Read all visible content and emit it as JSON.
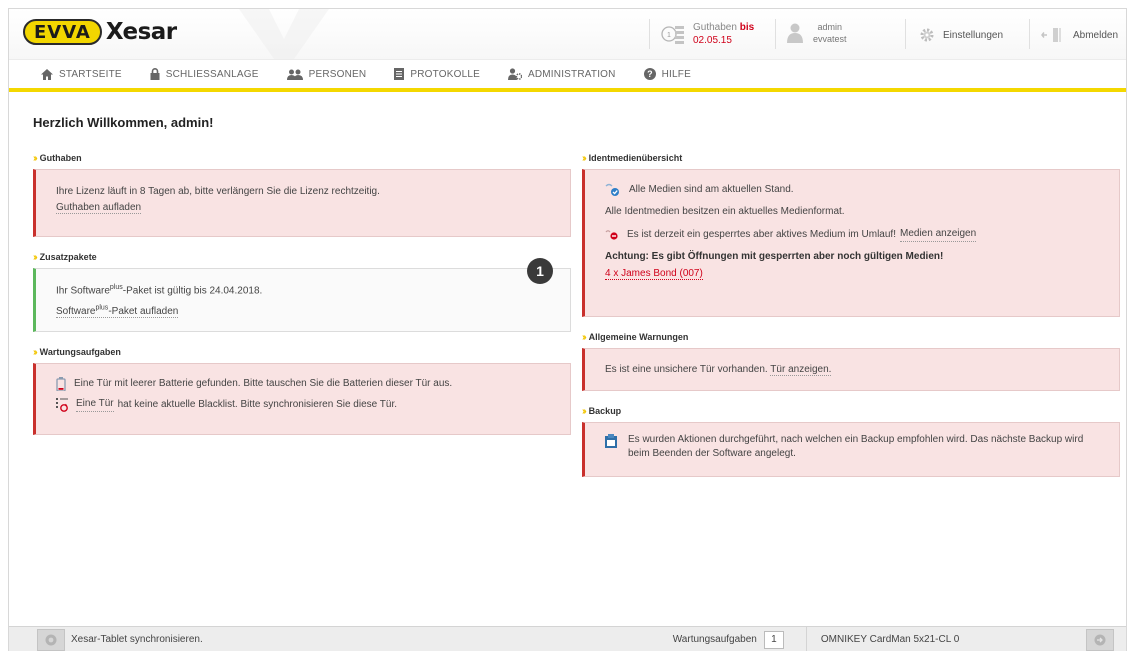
{
  "header": {
    "logo_badge": "EVVA",
    "app_name": "Xesar",
    "credit": {
      "label": "Guthaben",
      "until_word": "bis",
      "date": "02.05.15"
    },
    "user": {
      "name": "admin",
      "tenant": "evvatest"
    },
    "settings_label": "Einstellungen",
    "logout_label": "Abmelden"
  },
  "nav": {
    "items": [
      {
        "label": "STARTSEITE",
        "icon": "home-icon"
      },
      {
        "label": "SCHLIESSANLAGE",
        "icon": "lock-icon"
      },
      {
        "label": "PERSONEN",
        "icon": "people-icon"
      },
      {
        "label": "PROTOKOLLE",
        "icon": "document-icon"
      },
      {
        "label": "ADMINISTRATION",
        "icon": "admin-icon"
      },
      {
        "label": "HILFE",
        "icon": "help-icon"
      }
    ]
  },
  "welcome": "Herzlich Willkommen, admin!",
  "left": {
    "credit": {
      "title": "Guthaben",
      "text": "Ihre Lizenz läuft in 8 Tagen ab, bitte verlängern Sie die Lizenz rechtzeitig.",
      "link": "Guthaben aufladen"
    },
    "packages": {
      "title": "Zusatzpakete",
      "text_pre": "Ihr Software",
      "sup": "plus",
      "text_post": "-Paket ist gültig bis 24.04.2018.",
      "link_pre": "Software",
      "link_sup": "plus",
      "link_post": "-Paket aufladen"
    },
    "maintenance": {
      "title": "Wartungsaufgaben",
      "line1": "Eine Tür mit leerer Batterie gefunden. Bitte tauschen Sie die Batterien dieser Tür aus.",
      "line2_link": "Eine Tür",
      "line2_rest": "hat keine aktuelle Blacklist. Bitte synchronisieren Sie diese Tür."
    }
  },
  "right": {
    "media": {
      "title": "Identmedienübersicht",
      "line1": "Alle Medien sind am aktuellen Stand.",
      "line2": "Alle Identmedien besitzen ein aktuelles Medienformat.",
      "line3": "Es ist derzeit ein gesperrtes aber aktives Medium im Umlauf!",
      "line3_link": "Medien anzeigen",
      "warning": "Achtung: Es gibt Öffnungen mit gesperrten aber noch gültigen Medien!",
      "warning_link": "4 x James Bond (007)"
    },
    "general": {
      "title": "Allgemeine Warnungen",
      "text": "Es ist eine unsichere Tür vorhanden.",
      "link": "Tür anzeigen."
    },
    "backup": {
      "title": "Backup",
      "text": "Es wurden Aktionen durchgeführt, nach welchen ein Backup empfohlen wird. Das nächste Backup wird beim Beenden der Software angelegt."
    }
  },
  "marker": "1",
  "status": {
    "sync_label": "Xesar-Tablet synchronisieren.",
    "tasks_label": "Wartungsaufgaben",
    "tasks_count": "1",
    "reader": "OMNIKEY CardMan 5x21-CL 0"
  },
  "colors": {
    "accent_yellow": "#f4d800",
    "alert_red": "#c9302c",
    "ok_green": "#5cb85c",
    "alert_bg": "#f9e3e3"
  }
}
